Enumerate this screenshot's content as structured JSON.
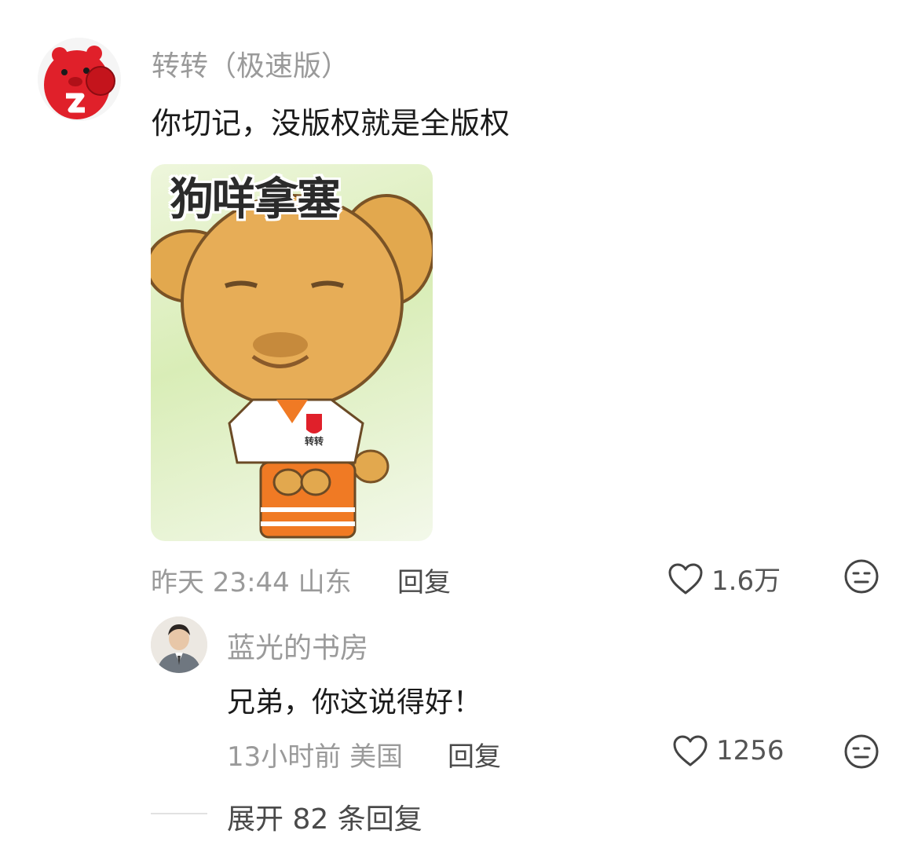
{
  "comment": {
    "username": "转转（极速版）",
    "text": "你切记，没版权就是全版权",
    "meme_caption": "狗咩拿塞",
    "meme_badge": "转转",
    "time": "昨天 23:44",
    "location": "山东",
    "reply_label": "回复",
    "like_count": "1.6万"
  },
  "sub_comment": {
    "username": "蓝光的书房",
    "text": "兄弟，你这说得好！",
    "time": "13小时前",
    "location": "美国",
    "reply_label": "回复",
    "like_count": "1256"
  },
  "expand_replies": {
    "label": "展开 82 条回复"
  },
  "icons": {
    "like": "heart-outline-icon",
    "dislike": "neutral-face-icon"
  },
  "colors": {
    "muted_text": "#9a9a9a",
    "main_text": "#1b1b1b",
    "brand_red": "#e0202a"
  }
}
